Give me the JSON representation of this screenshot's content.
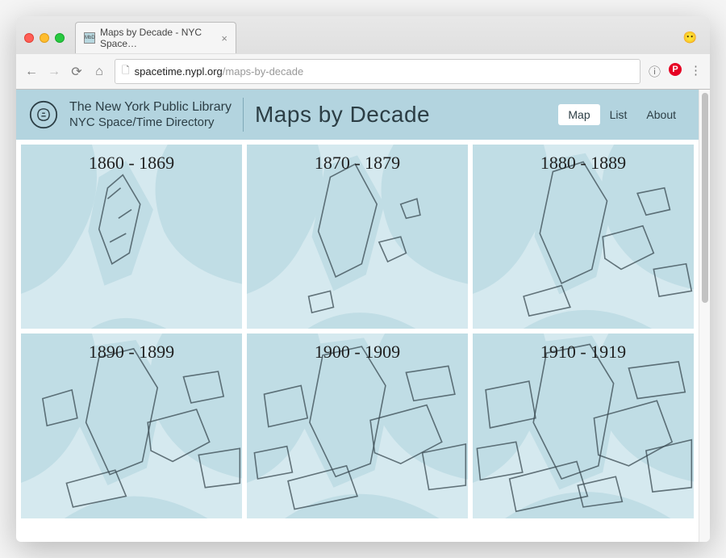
{
  "browser": {
    "tab_title": "Maps by Decade - NYC Space…",
    "url_host": "spacetime.nypl.org",
    "url_path": "/maps-by-decade"
  },
  "header": {
    "org_line1": "The New York Public Library",
    "org_line2": "NYC Space/Time Directory",
    "title": "Maps by Decade",
    "nav": [
      "Map",
      "List",
      "About"
    ],
    "active_nav": "Map"
  },
  "decades": [
    {
      "label": "1860 - 1869"
    },
    {
      "label": "1870 - 1879"
    },
    {
      "label": "1880 - 1889"
    },
    {
      "label": "1890 - 1899"
    },
    {
      "label": "1900 - 1909"
    },
    {
      "label": "1910 - 1919"
    }
  ],
  "colors": {
    "header_bg": "#b3d4df",
    "water": "#d5e9ef",
    "land": "#c0dde5",
    "outline": "#3a4a52"
  }
}
